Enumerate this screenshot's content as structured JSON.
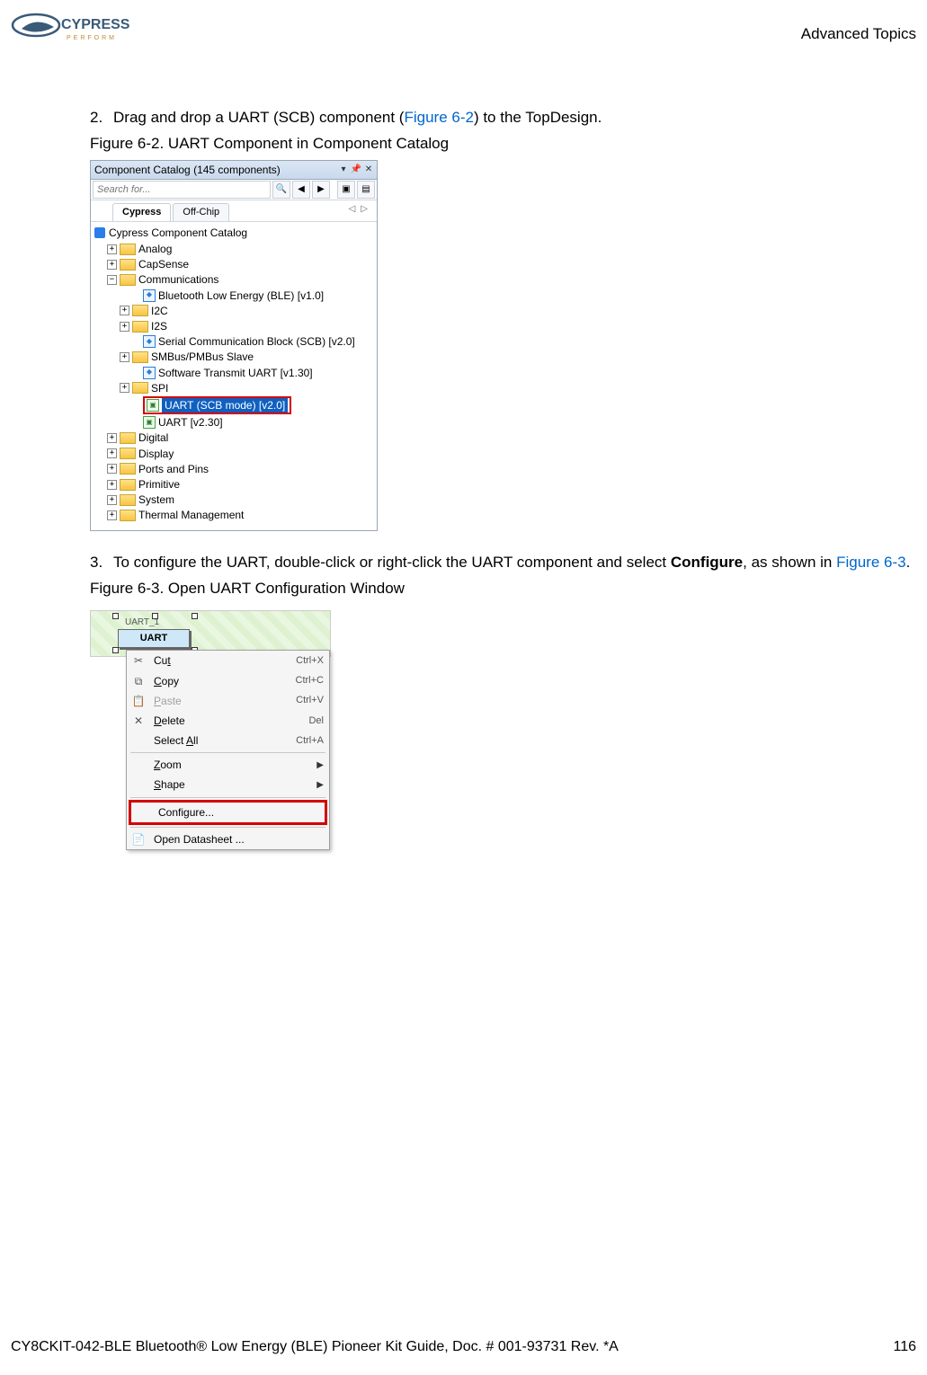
{
  "header": {
    "brand_top": "CYPRESS",
    "brand_sub": "P E R F O R M",
    "section": "Advanced Topics"
  },
  "step2": {
    "num": "2.",
    "text_before": "Drag and drop a UART (SCB) component (",
    "fig_link": "Figure 6-2",
    "text_after": ") to the TopDesign."
  },
  "fig62_caption": "Figure 6-2.  UART Component in Component Catalog",
  "fig62": {
    "title": "Component Catalog (145 components)",
    "search_placeholder": "Search for...",
    "tab_cypress": "Cypress",
    "tab_offchip": "Off-Chip",
    "root": "Cypress Component Catalog",
    "cat_analog": "Analog",
    "cat_capsense": "CapSense",
    "cat_comm": "Communications",
    "comm_ble": "Bluetooth Low Energy (BLE) [v1.0]",
    "comm_i2c": "I2C",
    "comm_i2s": "I2S",
    "comm_scb": "Serial Communication Block (SCB) [v2.0]",
    "comm_smbus": "SMBus/PMBus Slave",
    "comm_swuart": "Software Transmit UART [v1.30]",
    "comm_spi": "SPI",
    "comm_uart_scb": "UART (SCB mode) [v2.0]",
    "comm_uart": "UART [v2.30]",
    "cat_digital": "Digital",
    "cat_display": "Display",
    "cat_ports": "Ports and Pins",
    "cat_primitive": "Primitive",
    "cat_system": "System",
    "cat_thermal": "Thermal Management"
  },
  "step3": {
    "num": "3.",
    "text_before": "To configure the UART, double-click or right-click the UART component and select ",
    "bold": "Configure",
    "text_mid": ", as shown in ",
    "fig_link": "Figure 6-3",
    "text_after": "."
  },
  "fig63_caption": "Figure 6-3.  Open UART Configuration Window",
  "fig63": {
    "comp_instance": "UART_1",
    "comp_label": "UART",
    "menu": {
      "cut": "Cut",
      "cut_u": "t",
      "cut_s": "Ctrl+X",
      "copy": "Copy",
      "copy_u": "C",
      "copy_s": "Ctrl+C",
      "paste": "Paste",
      "paste_u": "P",
      "paste_s": "Ctrl+V",
      "delete": "Delete",
      "delete_u": "D",
      "delete_s": "Del",
      "selectall": "Select All",
      "selectall_u": "A",
      "selectall_s": "Ctrl+A",
      "zoom": "Zoom",
      "zoom_u": "Z",
      "shape": "Shape",
      "shape_u": "S",
      "configure": "Configure...",
      "datasheet": "Open Datasheet ..."
    }
  },
  "footer": {
    "doc": "CY8CKIT-042-BLE Bluetooth® Low Energy (BLE) Pioneer Kit Guide, Doc. # 001-93731 Rev. *A",
    "page": "116"
  }
}
